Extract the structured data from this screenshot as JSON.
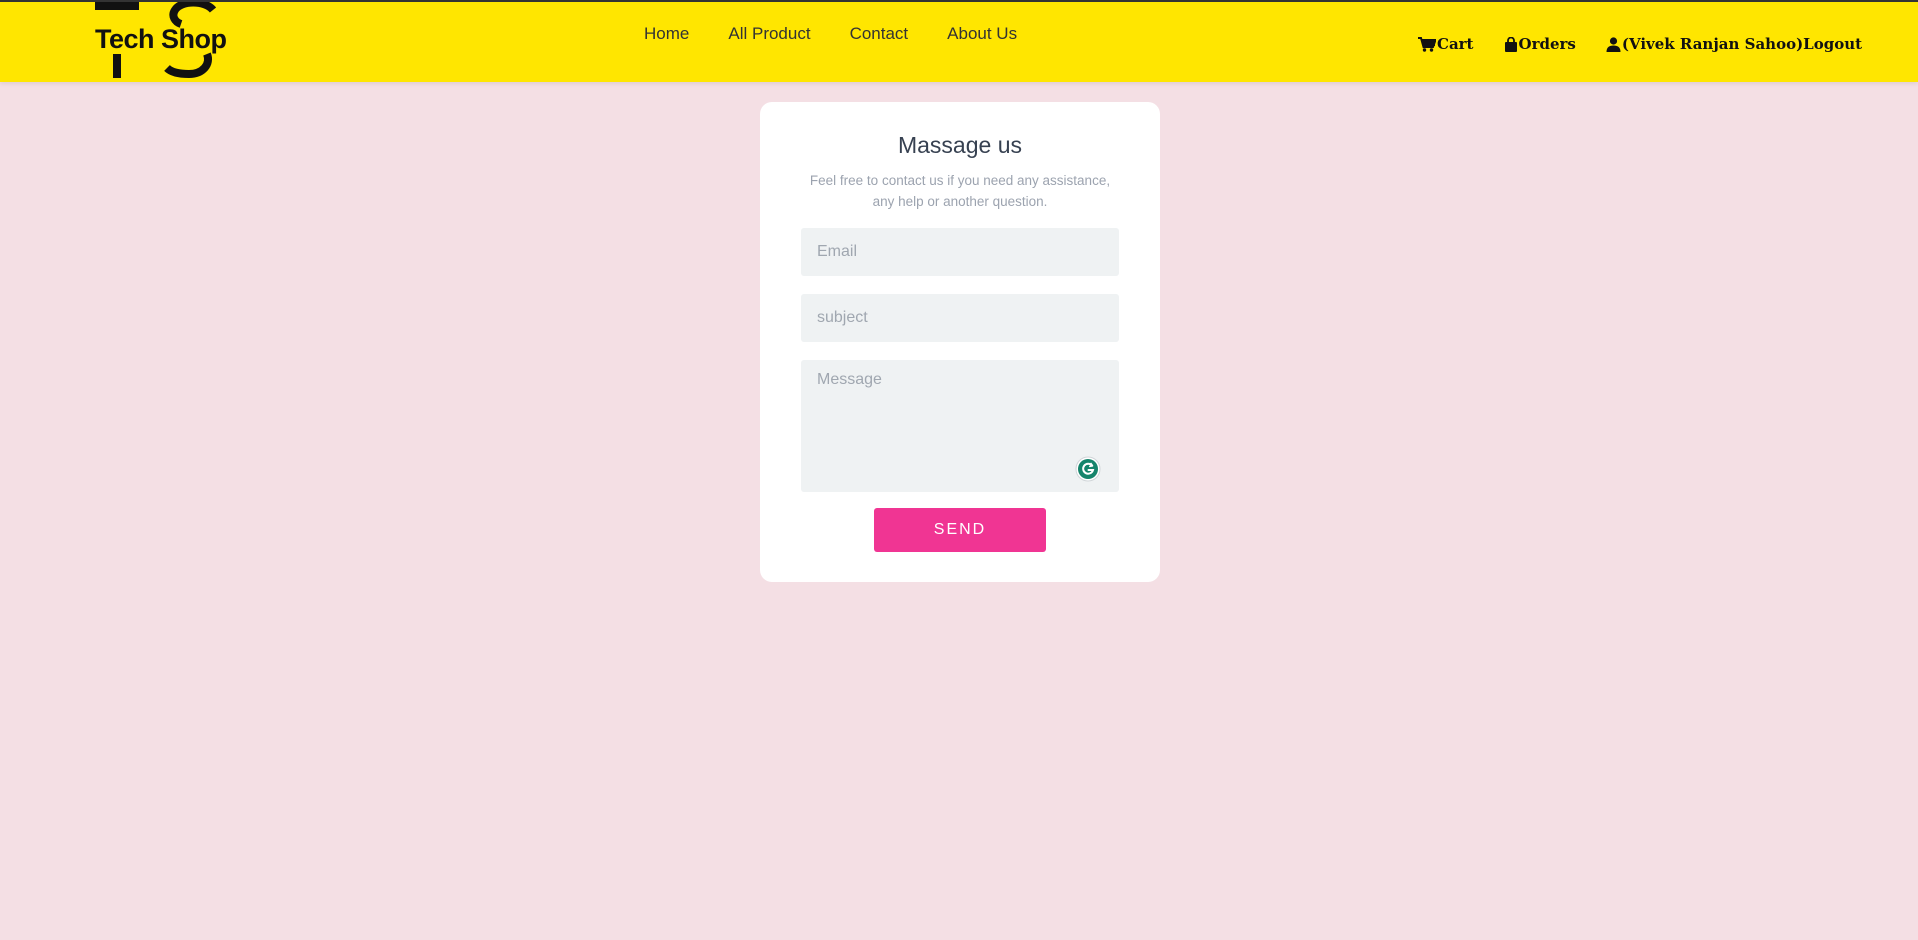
{
  "header": {
    "logo_text": "Tech Shop",
    "nav": [
      {
        "label": "Home"
      },
      {
        "label": "All Product"
      },
      {
        "label": "Contact"
      },
      {
        "label": "About Us"
      }
    ],
    "right": {
      "cart_label": "Cart",
      "orders_label": "Orders",
      "user_logout_label": "(Vivek Ranjan Sahoo)Logout"
    }
  },
  "contact": {
    "title": "Massage us",
    "subtitle": "Feel free to contact us if you need any assistance, any help or another question.",
    "email_placeholder": "Email",
    "subject_placeholder": "subject",
    "message_placeholder": "Message",
    "send_label": "SEND"
  },
  "colors": {
    "header_bg": "#ffe600",
    "page_bg": "#f4dfe4",
    "send_button": "#f03593",
    "grammarly": "#15846b"
  },
  "icons": {
    "cart": "cart-icon",
    "orders": "shopping-bag-icon",
    "user": "user-icon",
    "grammarly": "grammarly-icon"
  }
}
